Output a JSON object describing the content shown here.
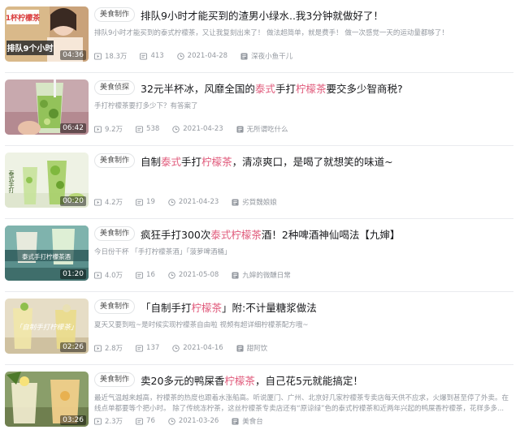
{
  "items": [
    {
      "tag": "美食制作",
      "title_parts": [
        "排队9小时才能买到的渣男小绿水..我3分钟就做好了！"
      ],
      "desc": "排队9小时才能买到的泰式柠檬茶，又让我复刻出来了！ 做法超简单，就是费手！ 做一次感觉一天的运动量都够了！",
      "duration": "04:36",
      "views": "18.3万",
      "danmaku": "413",
      "date": "2021-04-28",
      "author": "深夜小鱼干儿",
      "thumb_text": [
        "1杯柠檬茶",
        "排队9个小时"
      ]
    },
    {
      "tag": "美食侦探",
      "title_parts": [
        "32元半杯冰，风靡全国的",
        "泰式",
        "手打",
        "柠檬茶",
        "要交多少智商税?"
      ],
      "desc": "手打柠檬茶要打多少下？有答案了",
      "duration": "06:42",
      "views": "9.2万",
      "danmaku": "538",
      "date": "2021-04-23",
      "author": "无所谓吃什么"
    },
    {
      "tag": "美食制作",
      "title_parts": [
        "自制",
        "泰式",
        "手打",
        "柠檬茶",
        "，清凉爽口，是喝了就想笑的味道~"
      ],
      "desc": "",
      "duration": "00:20",
      "views": "4.2万",
      "danmaku": "19",
      "date": "2021-04-23",
      "author": "劣質魏娘娘",
      "thumb_text": [
        "泰式手打"
      ]
    },
    {
      "tag": "美食制作",
      "title_parts": [
        "疯狂手打300次",
        "泰式柠檬茶",
        "酒！2种啤酒神仙喝法【九婶】"
      ],
      "desc": "今日份干杯 「手打柠檬茶酒」「菠萝啤酒桶」",
      "duration": "01:20",
      "views": "4.0万",
      "danmaku": "16",
      "date": "2021-05-08",
      "author": "九婶的微醺日常",
      "thumb_text": [
        "泰式手打柠檬茶酒"
      ]
    },
    {
      "tag": "美食制作",
      "title_parts": [
        "「自制手打",
        "柠檬茶",
        "」附:不计量糖浆做法"
      ],
      "desc": "夏天又要到啦~是时候实现柠檬茶自由啦 视频有超详细柠檬茶配方哦~",
      "duration": "02:26",
      "views": "2.8万",
      "danmaku": "137",
      "date": "2021-04-16",
      "author": "甜阿饮",
      "thumb_text": [
        "「自制手打柠檬茶」"
      ]
    },
    {
      "tag": "美食制作",
      "title_parts": [
        "卖20多元的鸭屎香",
        "柠檬茶",
        "，自己花5元就能搞定！"
      ],
      "desc": "最近气温越来越高，柠檬茶的热度也跟着水涨船高。听说厦门、广州、北京好几家柠檬茶专卖店每天供不应求，火爆到甚至停了外卖。在线点单都要等个把小时。 除了传统冻柠茶，这丝柠檬茶专卖店还有“原谅绿”色的泰式柠檬茶和近两年兴起的鸭屎香柠檬茶，花样多多...",
      "duration": "03:26",
      "views": "2.3万",
      "danmaku": "76",
      "date": "2021-03-26",
      "author": "美食台"
    }
  ],
  "highlight_words": [
    "泰式",
    "柠檬茶",
    "泰式柠檬茶"
  ],
  "colors": {
    "highlight": "#e05a7b",
    "meta": "#9499a0"
  },
  "icons": {
    "views": "play-count-icon",
    "danmaku": "danmaku-icon",
    "date": "clock-icon",
    "author": "uploader-icon"
  }
}
